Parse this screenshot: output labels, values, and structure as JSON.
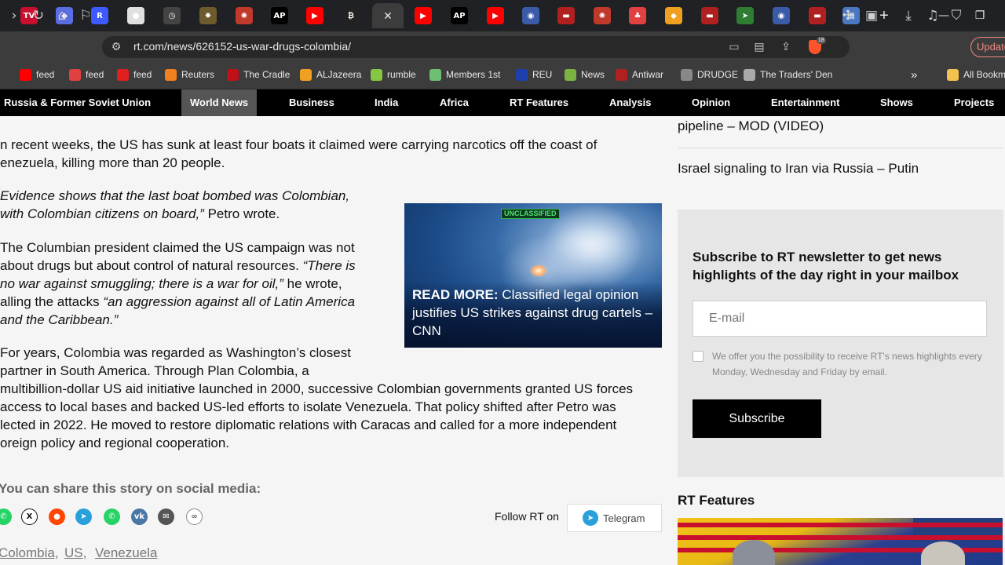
{
  "browser": {
    "url": "rt.com/news/626152-us-war-drugs-colombia/",
    "tabs": [
      {
        "icon": "rt-icon",
        "text": "TV",
        "color": "#c8102e"
      },
      {
        "icon": "proton-icon",
        "text": "◆",
        "color": "#5b6ee1"
      },
      {
        "icon": "r-icon",
        "text": "R",
        "color": "#3d5afe"
      },
      {
        "icon": "chrome-ball-icon",
        "text": "●",
        "color": "#e0e0e0"
      },
      {
        "icon": "clock-icon",
        "text": "◷",
        "color": "#444444"
      },
      {
        "icon": "seal-icon",
        "text": "✸",
        "color": "#6d5a2d"
      },
      {
        "icon": "sun-ring-icon",
        "text": "✺",
        "color": "#c0392b"
      },
      {
        "icon": "ap-icon",
        "text": "AP",
        "color": "#000000"
      },
      {
        "icon": "youtube-icon",
        "text": "▶",
        "color": "#ff0000"
      },
      {
        "icon": "bitcoin-icon",
        "text": "₿",
        "color": "#222222"
      },
      {
        "icon": "youtube-icon",
        "text": "▶",
        "color": "#ff0000"
      },
      {
        "icon": "ap-icon",
        "text": "AP",
        "color": "#000000"
      },
      {
        "icon": "youtube-icon",
        "text": "▶",
        "color": "#ff0000"
      },
      {
        "icon": "user-icon",
        "text": "◉",
        "color": "#3b5aa8"
      },
      {
        "icon": "flag-icon",
        "text": "▬",
        "color": "#b02020"
      },
      {
        "icon": "sun-ring-icon",
        "text": "✺",
        "color": "#c0392b"
      },
      {
        "icon": "mushroom-icon",
        "text": "♣",
        "color": "#e04040"
      },
      {
        "icon": "al-jazeera-icon",
        "text": "◆",
        "color": "#f0a020"
      },
      {
        "icon": "flag-icon",
        "text": "▬",
        "color": "#b02020"
      },
      {
        "icon": "arrow-icon",
        "text": "➤",
        "color": "#2e7d32"
      },
      {
        "icon": "user-icon",
        "text": "◉",
        "color": "#3b5aa8"
      },
      {
        "icon": "flag-icon",
        "text": "▬",
        "color": "#b02020"
      },
      {
        "icon": "document-icon",
        "text": "▤",
        "color": "#4a78c0"
      }
    ],
    "bookmarks": [
      {
        "label": "feed",
        "icon": "youtube-icon",
        "color": "#ff0000"
      },
      {
        "label": "feed",
        "icon": "mushroom-icon",
        "color": "#e04040"
      },
      {
        "label": "feed",
        "icon": "c-icon",
        "color": "#e02020"
      },
      {
        "label": "Reuters",
        "icon": "reuters-icon",
        "color": "#f08020"
      },
      {
        "label": "The Cradle",
        "icon": "cradle-icon",
        "color": "#c0101a"
      },
      {
        "label": "ALJazeera",
        "icon": "al-jazeera-icon",
        "color": "#f0a020"
      },
      {
        "label": "rumble",
        "icon": "rumble-icon",
        "color": "#85c742"
      },
      {
        "label": "Members 1st",
        "icon": "mountain-icon",
        "color": "#6fbf73"
      },
      {
        "label": "REU",
        "icon": "reu-icon",
        "color": "#1e40af"
      },
      {
        "label": "News",
        "icon": "news-icon",
        "color": "#7cb342"
      },
      {
        "label": "Antiwar",
        "icon": "antiwar-icon",
        "color": "#b02020"
      },
      {
        "label": "DRUDGE",
        "icon": "drudge-icon",
        "color": "#888888"
      },
      {
        "label": "The Traders' Den",
        "icon": "traders-den-icon",
        "color": "#aaaaaa"
      }
    ],
    "all_bookmarks": "All Bookm",
    "update_label": "Update",
    "extension_badge": "18"
  },
  "site_nav": {
    "items": [
      "Russia & Former Soviet Union",
      "World News",
      "Business",
      "India",
      "Africa",
      "RT Features",
      "Analysis",
      "Opinion",
      "Entertainment",
      "Shows",
      "Projects"
    ],
    "active": "World News"
  },
  "article": {
    "p1": "n recent weeks, the US has sunk at least four boats it claimed were carrying narcotics off the coast of",
    "p1b": "enezuela, killing more than 20 people.",
    "q1a": "Evidence shows that the last boat bombed was Colombian,",
    "q1b": "with Colombian citizens on board,”",
    "q1c": " Petro wrote.",
    "p3a": "The Columbian president claimed the US campaign was not",
    "p3b": "about drugs but about control of natural resources. ",
    "p3b_q": "“There is",
    "p3c_q": "no war against smuggling; there is a war for oil,”",
    "p3c": " he wrote,",
    "p3d": "alling the attacks ",
    "p3d_q": "“an aggression against all of Latin America",
    "p3e_q": "and the Caribbean.”",
    "p4a": "For years, Colombia was regarded as Washington’s closest",
    "p4b": "partner in South America. Through Plan Colombia, a",
    "p4c": "multibillion-dollar US aid initiative launched in 2000, successive Colombian governments granted US forces",
    "p4d": "access to local bases and backed US-led efforts to isolate Venezuela. That policy shifted after Petro was",
    "p4e": "lected in 2022. He moved to restore diplomatic relations with Caracas and called for a more independent",
    "p4f": "oreign policy and regional cooperation.",
    "read_more": {
      "label": "READ MORE:",
      "text": " Classified legal opinion justifies US strikes against drug cartels – CNN",
      "badge": "UNCLASSIFIED"
    },
    "share_title": "You can share this story on social media:",
    "follow_label": "Follow RT on",
    "telegram_label": "Telegram",
    "tags": [
      "Colombia,",
      "US,",
      "Venezuela"
    ]
  },
  "sidebar": {
    "link1": "pipeline – MOD (VIDEO)",
    "link2": "Israel signaling to Iran via Russia – Putin",
    "newsletter": {
      "title": "Subscribe to RT newsletter to get news highlights of the day right in your mailbox",
      "email_placeholder": "E-mail",
      "note": "We offer you the possibility to receive RT's news highlights every Monday, Wednesday and Friday by email.",
      "submit_label": "Subscribe"
    },
    "features_title": "RT Features"
  }
}
